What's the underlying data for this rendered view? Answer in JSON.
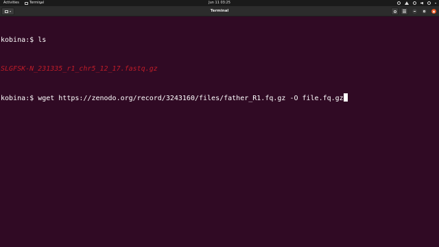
{
  "topbar": {
    "activities": "Activities",
    "app_name": "Terminal",
    "clock": "Jun 11  03:25"
  },
  "window": {
    "title": "Terminal"
  },
  "terminal": {
    "prompt1": "kobina:$ ",
    "cmd1": "ls",
    "output1": "SLGFSK-N_231335_r1_chr5_12_17.fastq.gz",
    "prompt2": "kobina:$ ",
    "cmd2": "wget https://zenodo.org/record/3243160/files/father_R1.fq.gz -O file.fq.gz",
    "colors": {
      "background": "#300a24",
      "text": "#ffffff",
      "file_highlight": "#c01c28"
    }
  }
}
